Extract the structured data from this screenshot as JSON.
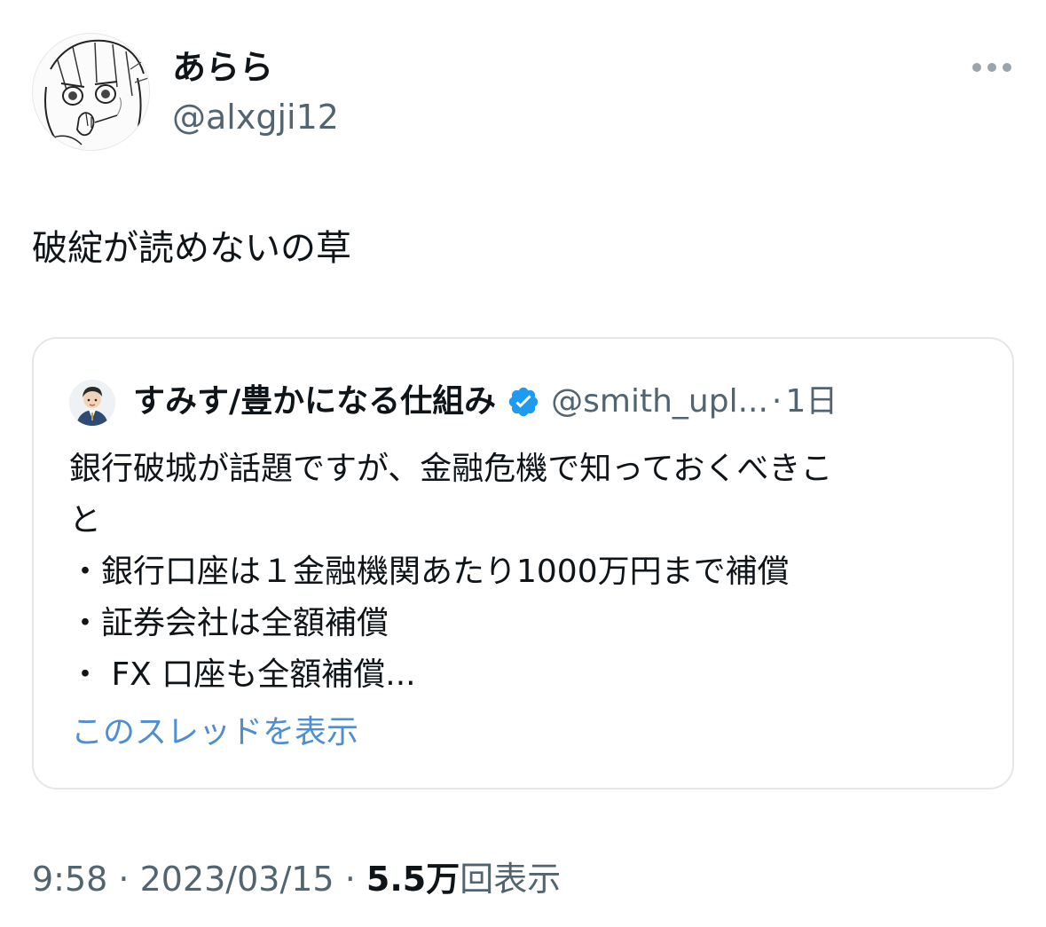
{
  "author": {
    "display_name": "あらら",
    "handle": "@alxgji12"
  },
  "tweet": {
    "text": "破綻が読めないの草"
  },
  "quote": {
    "name": "すみす/豊かになる仕組み",
    "handle": "@smith_upl...",
    "separator": "·",
    "time": "1日",
    "lines": [
      "銀行破城が話題ですが、金融危機で知っておくべきこ",
      "と",
      "・銀行口座は１金融機関あたり1000万円まで補償",
      "・証券会社は全額補償",
      "・ FX 口座も全額補償..."
    ],
    "show_thread": "このスレッドを表示"
  },
  "meta": {
    "time": "9:58",
    "sep1": " · ",
    "date": "2023/03/15",
    "sep2": " · ",
    "views_count": "5.5万",
    "views_label": "回表示"
  },
  "icons": {
    "more": "more-horizontal-icon",
    "verified": "verified-badge-icon"
  },
  "colors": {
    "link_blue": "#4e8ed4",
    "verified_blue": "#1d9bf0",
    "secondary_text": "#536471",
    "border": "#e3e7ea"
  }
}
